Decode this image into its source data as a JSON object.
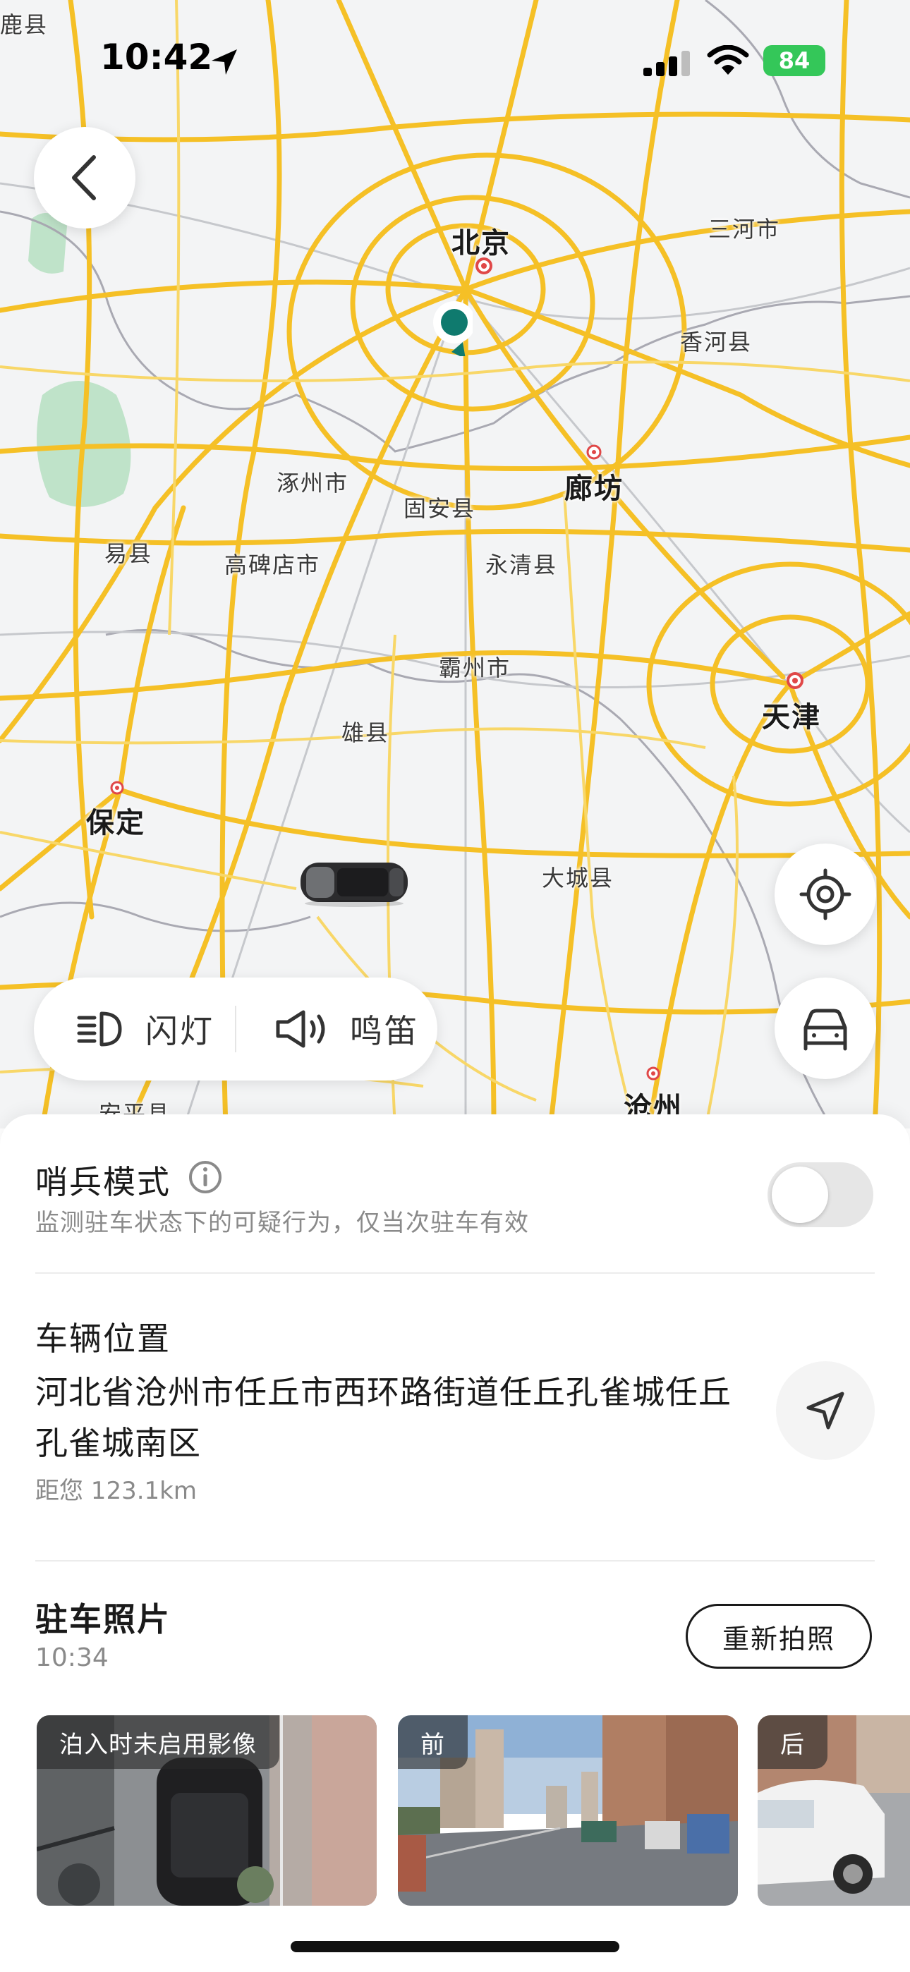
{
  "status_bar": {
    "time": "10:42",
    "battery": "84"
  },
  "map": {
    "cities": [
      {
        "name": "鹿县",
        "size": "small"
      },
      {
        "name": "北京",
        "size": "big"
      },
      {
        "name": "三河市",
        "size": "small"
      },
      {
        "name": "香河县",
        "size": "small"
      },
      {
        "name": "涿州市",
        "size": "small"
      },
      {
        "name": "廊坊",
        "size": "big"
      },
      {
        "name": "固安县",
        "size": "small"
      },
      {
        "name": "易县",
        "size": "small"
      },
      {
        "name": "高碑店市",
        "size": "small"
      },
      {
        "name": "永清县",
        "size": "small"
      },
      {
        "name": "霸州市",
        "size": "small"
      },
      {
        "name": "天津",
        "size": "big"
      },
      {
        "name": "雄县",
        "size": "small"
      },
      {
        "name": "保定",
        "size": "big"
      },
      {
        "name": "大城县",
        "size": "small"
      },
      {
        "name": "沧州",
        "size": "big"
      },
      {
        "name": "安平县",
        "size": "small"
      }
    ],
    "colors": {
      "background": "#f3f4f5",
      "road": "#f5c026",
      "marker": "#0f7a6e"
    }
  },
  "quick_actions": {
    "flash_label": "闪灯",
    "horn_label": "鸣笛"
  },
  "sentry": {
    "title": "哨兵模式",
    "description": "监测驻车状态下的可疑行为，仅当次驻车有效",
    "enabled": false
  },
  "vehicle_location": {
    "title": "车辆位置",
    "address": "河北省沧州市任丘市西环路街道任丘孔雀城任丘孔雀城南区",
    "distance": "距您 123.1km"
  },
  "parking_photos": {
    "title": "驻车照片",
    "time": "10:34",
    "retake_label": "重新拍照",
    "photos": [
      {
        "tag": "泊入时未启用影像"
      },
      {
        "tag": "前"
      },
      {
        "tag": "后"
      }
    ]
  }
}
